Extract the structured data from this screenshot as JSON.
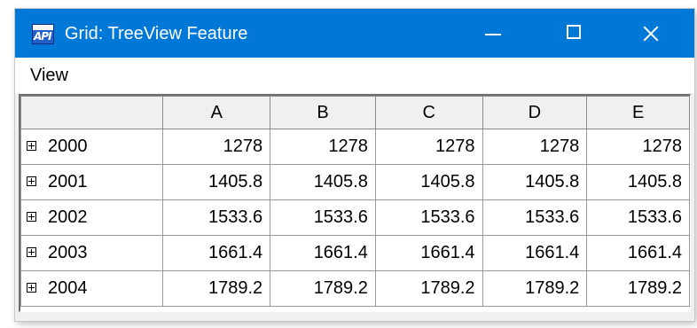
{
  "window": {
    "title": "Grid: TreeView Feature",
    "icon": "api-app-icon",
    "icon_text": "API",
    "accent_color": "#0078d7"
  },
  "menu": {
    "items": [
      {
        "label": "View"
      }
    ]
  },
  "grid": {
    "columns": [
      "A",
      "B",
      "C",
      "D",
      "E"
    ],
    "rows": [
      {
        "label": "2000",
        "values": [
          "1278",
          "1278",
          "1278",
          "1278",
          "1278"
        ]
      },
      {
        "label": "2001",
        "values": [
          "1405.8",
          "1405.8",
          "1405.8",
          "1405.8",
          "1405.8"
        ]
      },
      {
        "label": "2002",
        "values": [
          "1533.6",
          "1533.6",
          "1533.6",
          "1533.6",
          "1533.6"
        ]
      },
      {
        "label": "2003",
        "values": [
          "1661.4",
          "1661.4",
          "1661.4",
          "1661.4",
          "1661.4"
        ]
      },
      {
        "label": "2004",
        "values": [
          "1789.2",
          "1789.2",
          "1789.2",
          "1789.2",
          "1789.2"
        ]
      }
    ]
  }
}
